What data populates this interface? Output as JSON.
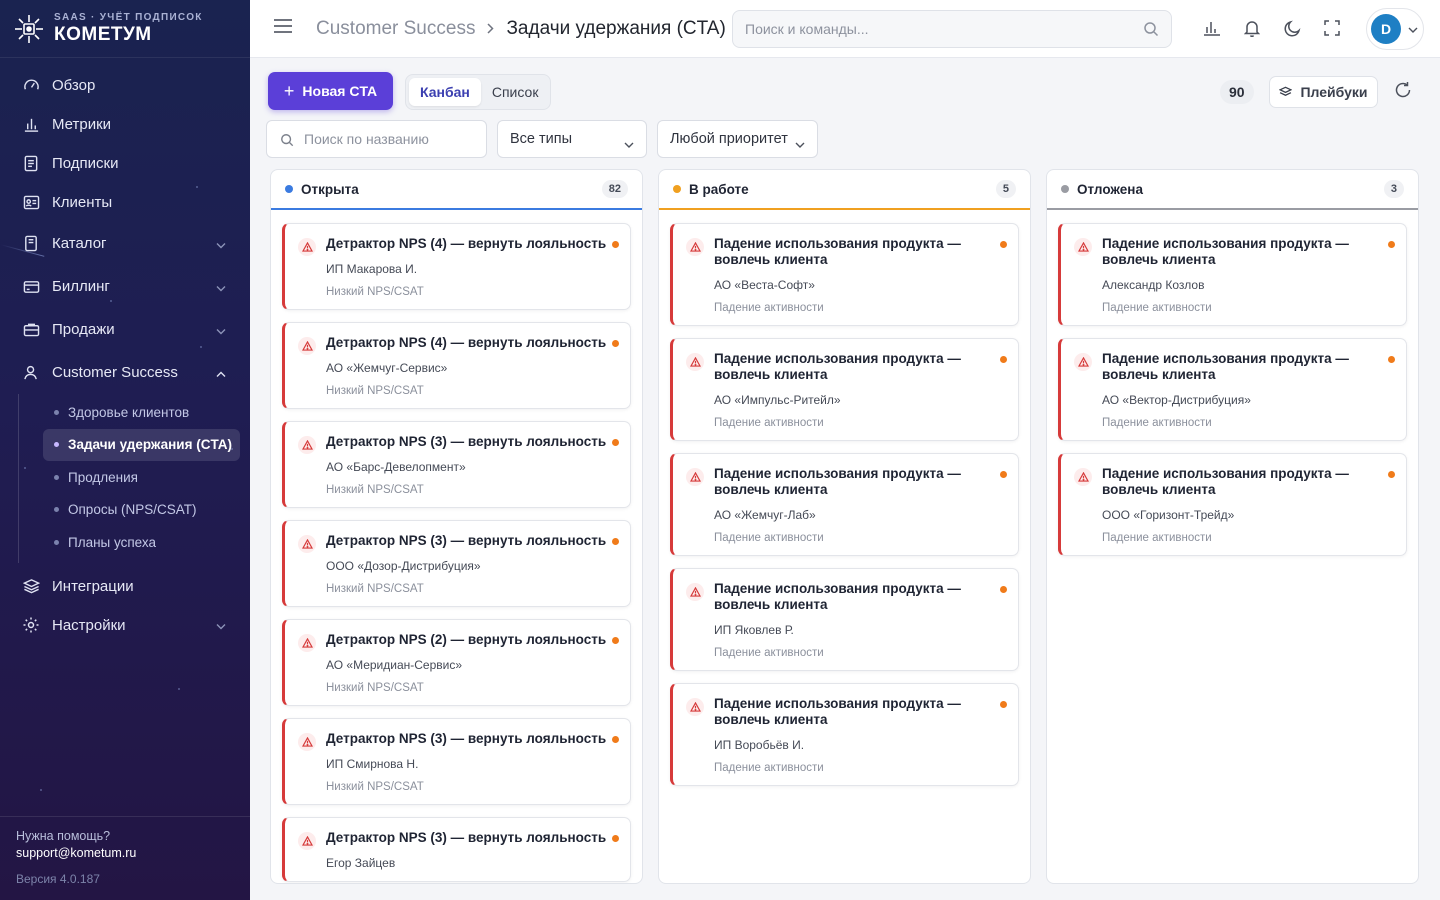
{
  "brand": {
    "subtitle": "SAAS · УЧЁТ ПОДПИСОК",
    "name": "КОМЕТУМ"
  },
  "nav": {
    "items": [
      {
        "label": "Обзор",
        "icon": "gauge-icon"
      },
      {
        "label": "Метрики",
        "icon": "bar-chart-icon"
      },
      {
        "label": "Подписки",
        "icon": "document-icon"
      },
      {
        "label": "Клиенты",
        "icon": "id-card-icon"
      },
      {
        "label": "Каталог",
        "icon": "catalog-icon"
      },
      {
        "label": "Биллинг",
        "icon": "card-icon"
      },
      {
        "label": "Продажи",
        "icon": "briefcase-icon"
      },
      {
        "label": "Customer Success",
        "icon": "user-icon"
      },
      {
        "label": "Интеграции",
        "icon": "layers-icon"
      },
      {
        "label": "Настройки",
        "icon": "gear-icon"
      }
    ],
    "cs_sub": [
      {
        "label": "Здоровье клиентов"
      },
      {
        "label": "Задачи удержания (CTA)"
      },
      {
        "label": "Продления"
      },
      {
        "label": "Опросы (NPS/CSAT)"
      },
      {
        "label": "Планы успеха"
      }
    ]
  },
  "footer": {
    "help": "Нужна помощь?",
    "email": "support@kometum.ru",
    "version": "Версия 4.0.187"
  },
  "header": {
    "breadcrumb_parent": "Customer Success",
    "breadcrumb_current": "Задачи удержания (CTA)",
    "search_placeholder": "Поиск и команды...",
    "avatar_letter": "D"
  },
  "toolbar": {
    "new_label": "Новая CTA",
    "view_kanban": "Канбан",
    "view_list": "Список",
    "total": "90",
    "playbooks_label": "Плейбуки"
  },
  "filters": {
    "search_placeholder": "Поиск по названию",
    "type_value": "Все типы",
    "priority_value": "Любой приоритет"
  },
  "colors": {
    "open": "#3b7be0",
    "in_progress": "#f0a020",
    "postponed": "#9a9ca3",
    "accent": "#5b3fd8",
    "card_border": "#d63a3a",
    "priority_dot": "#f07b1a"
  },
  "columns": [
    {
      "title": "Открыта",
      "count": "82",
      "cards": [
        {
          "title": "Детрактор NPS (4) — вернуть лояльность",
          "client": "ИП Макарова И.",
          "reason": "Низкий NPS/CSAT"
        },
        {
          "title": "Детрактор NPS (4) — вернуть лояльность",
          "client": "АО «Жемчуг-Сервис»",
          "reason": "Низкий NPS/CSAT"
        },
        {
          "title": "Детрактор NPS (3) — вернуть лояльность",
          "client": "АО «Барс-Девелопмент»",
          "reason": "Низкий NPS/CSAT"
        },
        {
          "title": "Детрактор NPS (3) — вернуть лояльность",
          "client": "ООО «Дозор-Дистрибуция»",
          "reason": "Низкий NPS/CSAT"
        },
        {
          "title": "Детрактор NPS (2) — вернуть лояльность",
          "client": "АО «Меридиан-Сервис»",
          "reason": "Низкий NPS/CSAT"
        },
        {
          "title": "Детрактор NPS (3) — вернуть лояльность",
          "client": "ИП Смирнова Н.",
          "reason": "Низкий NPS/CSAT"
        },
        {
          "title": "Детрактор NPS (3) — вернуть лояльность",
          "client": "Егор Зайцев",
          "reason": ""
        }
      ]
    },
    {
      "title": "В работе",
      "count": "5",
      "cards": [
        {
          "title": "Падение использования продукта — вовлечь клиента",
          "client": "АО «Веста-Софт»",
          "reason": "Падение активности"
        },
        {
          "title": "Падение использования продукта — вовлечь клиента",
          "client": "АО «Импульс-Ритейл»",
          "reason": "Падение активности"
        },
        {
          "title": "Падение использования продукта — вовлечь клиента",
          "client": "АО «Жемчуг-Лаб»",
          "reason": "Падение активности"
        },
        {
          "title": "Падение использования продукта — вовлечь клиента",
          "client": "ИП Яковлев Р.",
          "reason": "Падение активности"
        },
        {
          "title": "Падение использования продукта — вовлечь клиента",
          "client": "ИП Воробьёв И.",
          "reason": "Падение активности"
        }
      ]
    },
    {
      "title": "Отложена",
      "count": "3",
      "cards": [
        {
          "title": "Падение использования продукта — вовлечь клиента",
          "client": "Александр Козлов",
          "reason": "Падение активности"
        },
        {
          "title": "Падение использования продукта — вовлечь клиента",
          "client": "АО «Вектор-Дистрибуция»",
          "reason": "Падение активности"
        },
        {
          "title": "Падение использования продукта — вовлечь клиента",
          "client": "ООО «Горизонт-Трейд»",
          "reason": "Падение активности"
        }
      ]
    }
  ]
}
